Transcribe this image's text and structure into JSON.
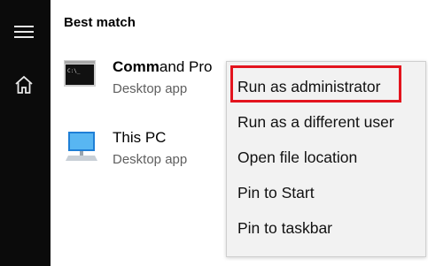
{
  "sidebar": {
    "menu_icon": "hamburger-menu-icon",
    "home_icon": "home-icon"
  },
  "search": {
    "section_title": "Best match",
    "results": [
      {
        "title_bold": "Comm",
        "title_rest": "and Pro",
        "subtitle": "Desktop app",
        "icon": "command-prompt-icon"
      },
      {
        "title": "This PC",
        "subtitle": "Desktop app",
        "icon": "this-pc-icon"
      }
    ]
  },
  "context_menu": {
    "items": [
      {
        "label": "Run as administrator",
        "highlighted": true
      },
      {
        "label": "Run as a different user"
      },
      {
        "label": "Open file location"
      },
      {
        "label": "Pin to Start"
      },
      {
        "label": "Pin to taskbar"
      }
    ],
    "highlight_color": "#e3141e"
  },
  "colors": {
    "sidebar_bg": "#0b0b0b",
    "menu_bg": "#f2f2f2"
  }
}
